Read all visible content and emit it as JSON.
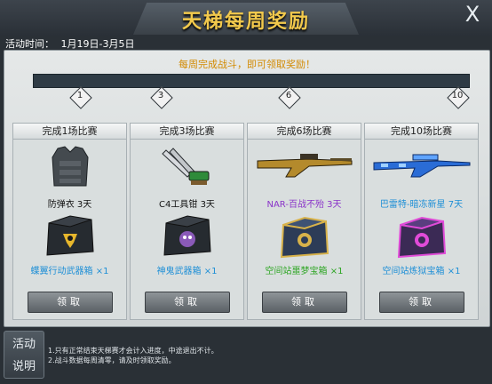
{
  "window": {
    "title": "天梯每周奖励",
    "close_label": "X"
  },
  "period": {
    "label": "活动时间：",
    "value": "1月19日-3月5日"
  },
  "progress": {
    "prompt": "每周完成战斗，即可领取奖励！",
    "milestones": [
      "1",
      "3",
      "6",
      "10"
    ]
  },
  "cards": [
    {
      "header": "完成1场比赛",
      "item_name": "防弹衣 3天",
      "item_color": "#111111",
      "box_name": "蝶翼行动武器箱",
      "box_qty": "×1",
      "claim": "领取",
      "box_color": "#1e8fd6"
    },
    {
      "header": "完成3场比赛",
      "item_name": "C4工具钳 3天",
      "item_color": "#111111",
      "box_name": "神鬼武器箱",
      "box_qty": "×1",
      "claim": "领取",
      "box_color": "#1e8fd6"
    },
    {
      "header": "完成6场比赛",
      "item_name": "NAR-百战不殆 3天",
      "item_color": "#8a34c9",
      "box_name": "空间站噩梦宝箱",
      "box_qty": "×1",
      "claim": "领取",
      "box_color": "#2ea524"
    },
    {
      "header": "完成10场比赛",
      "item_name": "巴雷特-暗冻新星 7天",
      "item_color": "#1e8fd6",
      "box_name": "空间站炼狱宝箱",
      "box_qty": "×1",
      "claim": "领取",
      "box_color": "#1e8fd6"
    }
  ],
  "info_button": [
    "活动",
    "说明"
  ],
  "rules": [
    "1.只有正常结束天梯赛才会计入进度，中途退出不计。",
    "2.战斗数据每周清零，请及时领取奖励。"
  ]
}
